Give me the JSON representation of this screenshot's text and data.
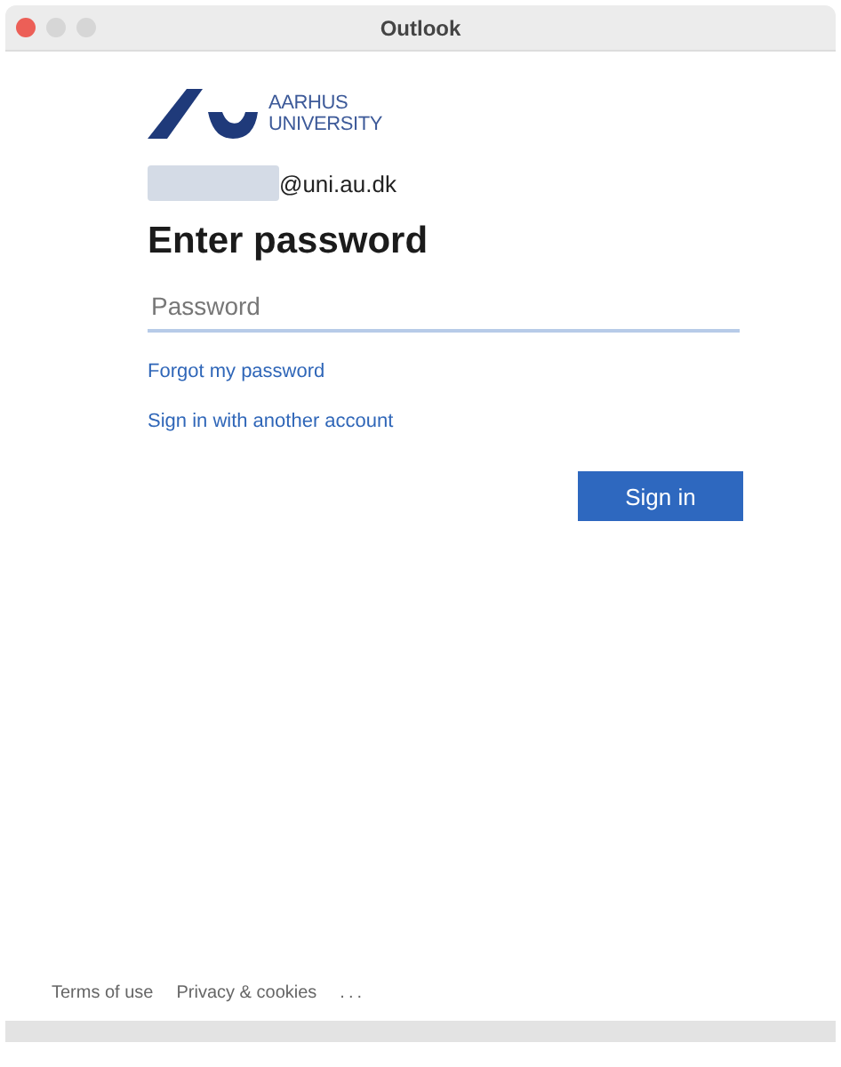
{
  "window": {
    "title": "Outlook"
  },
  "logo": {
    "line_1": "AARHUS",
    "line_2": "UNIVERSITY"
  },
  "account": "@uni.au.dk",
  "heading": "Enter password",
  "password_field": {
    "placeholder": "Password"
  },
  "links": [
    "Forgot my password",
    "Sign in with another account"
  ],
  "sign_in_button": "Sign in",
  "footer": [
    "Terms of use",
    "Privacy & cookies",
    "..."
  ]
}
